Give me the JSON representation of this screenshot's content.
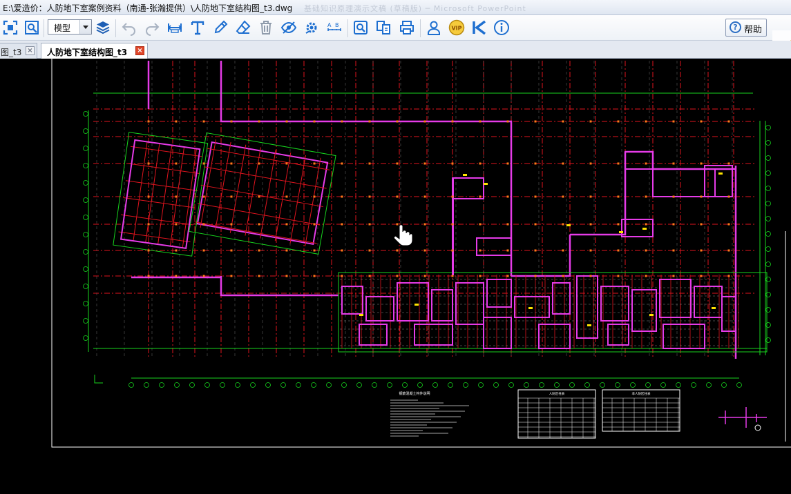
{
  "window": {
    "title": "E:\\爱造价：人防地下室案例资料（南通-张瀚提供）\\人防地下室结构图_t3.dwg",
    "ghost_text": "基础知识原理演示文稿 (草稿版) ─ Microsoft PowerPoint"
  },
  "toolbar": {
    "mode_value": "模型",
    "help_label": "帮助",
    "vip_label": "VIP",
    "icons": [
      "fit-window-icon",
      "zoom-window-icon",
      "layers-icon",
      "undo-icon",
      "redo-icon",
      "measure-icon",
      "text-icon",
      "pen-icon",
      "eraser-icon",
      "delete-icon",
      "hide-icon",
      "settings-icon",
      "scale-icon",
      "zoom-doc-icon",
      "compare-icon",
      "print-icon",
      "user-icon",
      "vip-icon",
      "brand-k-icon",
      "info-icon"
    ]
  },
  "tabs": [
    {
      "label": "图_t3",
      "active": false
    },
    {
      "label": "人防地下室结构图_t3",
      "active": true
    }
  ],
  "drawing": {
    "notes_title": "钢筋混凝土构件说明",
    "table1_title": "人防区柱表",
    "table2_title": "非人防区柱表",
    "colors": {
      "background": "#000000",
      "axis": "#e0141e",
      "wall": "#e63be8",
      "dimension": "#17d41e",
      "frame": "#ffffff"
    }
  }
}
